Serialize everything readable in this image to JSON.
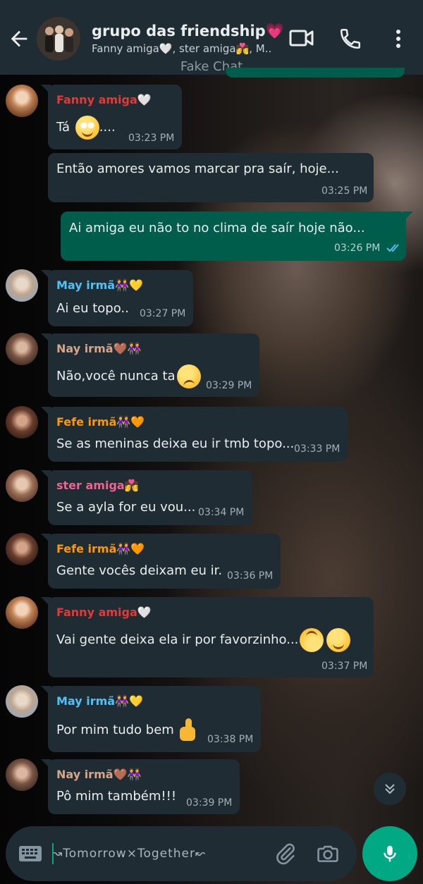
{
  "header": {
    "group_name": "grupo das friendship💗",
    "members": "Fanny amiga🤍, ster amiga💏, M..",
    "watermark": "Fake Chat"
  },
  "messages": [
    {
      "sender": "Fanny amiga",
      "sender_emoji": "🤍",
      "sender_color": "#e53935",
      "text": "Tá",
      "emoji": "roll-eyes",
      "text_after": "....",
      "time": "03:23 PM",
      "avatar": "fanny"
    },
    {
      "sender": "",
      "text": "Então amores vamos marcar pra saír, hoje...",
      "time": "03:25 PM",
      "avatar": ""
    },
    {
      "sender": "",
      "text": "Ai amiga eu não to no clima de saír hoje não...",
      "time": "03:26 PM",
      "outgoing": true,
      "read": true
    },
    {
      "sender": "May irmã",
      "sender_emoji": "👭💛",
      "sender_color": "#4fc3f7",
      "text": "Ai eu topo..",
      "time": "03:27 PM",
      "avatar": "may"
    },
    {
      "sender": "Nay irmã",
      "sender_emoji": "🤎👭",
      "sender_color": "#d7a58a",
      "text": "Não,você nunca ta",
      "emoji": "confused",
      "time": "03:29 PM",
      "avatar": "nay"
    },
    {
      "sender": "Fefe irmã",
      "sender_emoji": "👭🧡",
      "sender_color": "#ff9800",
      "text": "Se as meninas deixa eu ir tmb topo...",
      "time": "03:33 PM",
      "avatar": "fefe"
    },
    {
      "sender": "ster amiga",
      "sender_emoji": "💏",
      "sender_color": "#f06292",
      "text": "Se a ayla for eu vou...",
      "time": "03:34 PM",
      "avatar": "ster"
    },
    {
      "sender": "Fefe irmã",
      "sender_emoji": "👭🧡",
      "sender_color": "#ff9800",
      "text": "Gente vocês deixam eu ir.",
      "time": "03:36 PM",
      "avatar": "fefe"
    },
    {
      "sender": "Fanny amiga",
      "sender_emoji": "🤍",
      "sender_color": "#e53935",
      "text": "Vai gente deixa ela ir por favorzinho...",
      "emoji": "upside-smile",
      "time": "03:37 PM",
      "avatar": "fanny"
    },
    {
      "sender": "May irmã",
      "sender_emoji": "👭💛",
      "sender_color": "#4fc3f7",
      "text": "Por mim tudo bem",
      "emoji": "thumbs-up",
      "time": "03:38 PM",
      "avatar": "may"
    },
    {
      "sender": "Nay irmã",
      "sender_emoji": "🤎👭",
      "sender_color": "#d7a58a",
      "text": "Pô mim também!!!",
      "time": "03:39 PM",
      "avatar": "nay"
    }
  ],
  "composer": {
    "placeholder": "↝Tomorrow×Together↜"
  },
  "icons": {
    "back": "arrow-left-icon",
    "video": "video-camera-icon",
    "call": "phone-icon",
    "menu": "more-vertical-icon",
    "keyboard": "keyboard-icon",
    "attach": "paperclip-icon",
    "camera": "camera-icon",
    "mic": "microphone-icon",
    "scroll": "double-chevron-down-icon"
  },
  "colors": {
    "header_bg": "#1f2c34",
    "incoming_bubble": "#202c33",
    "outgoing_bubble": "#005c4b",
    "accent": "#00a884",
    "read_tick": "#53bdeb"
  }
}
